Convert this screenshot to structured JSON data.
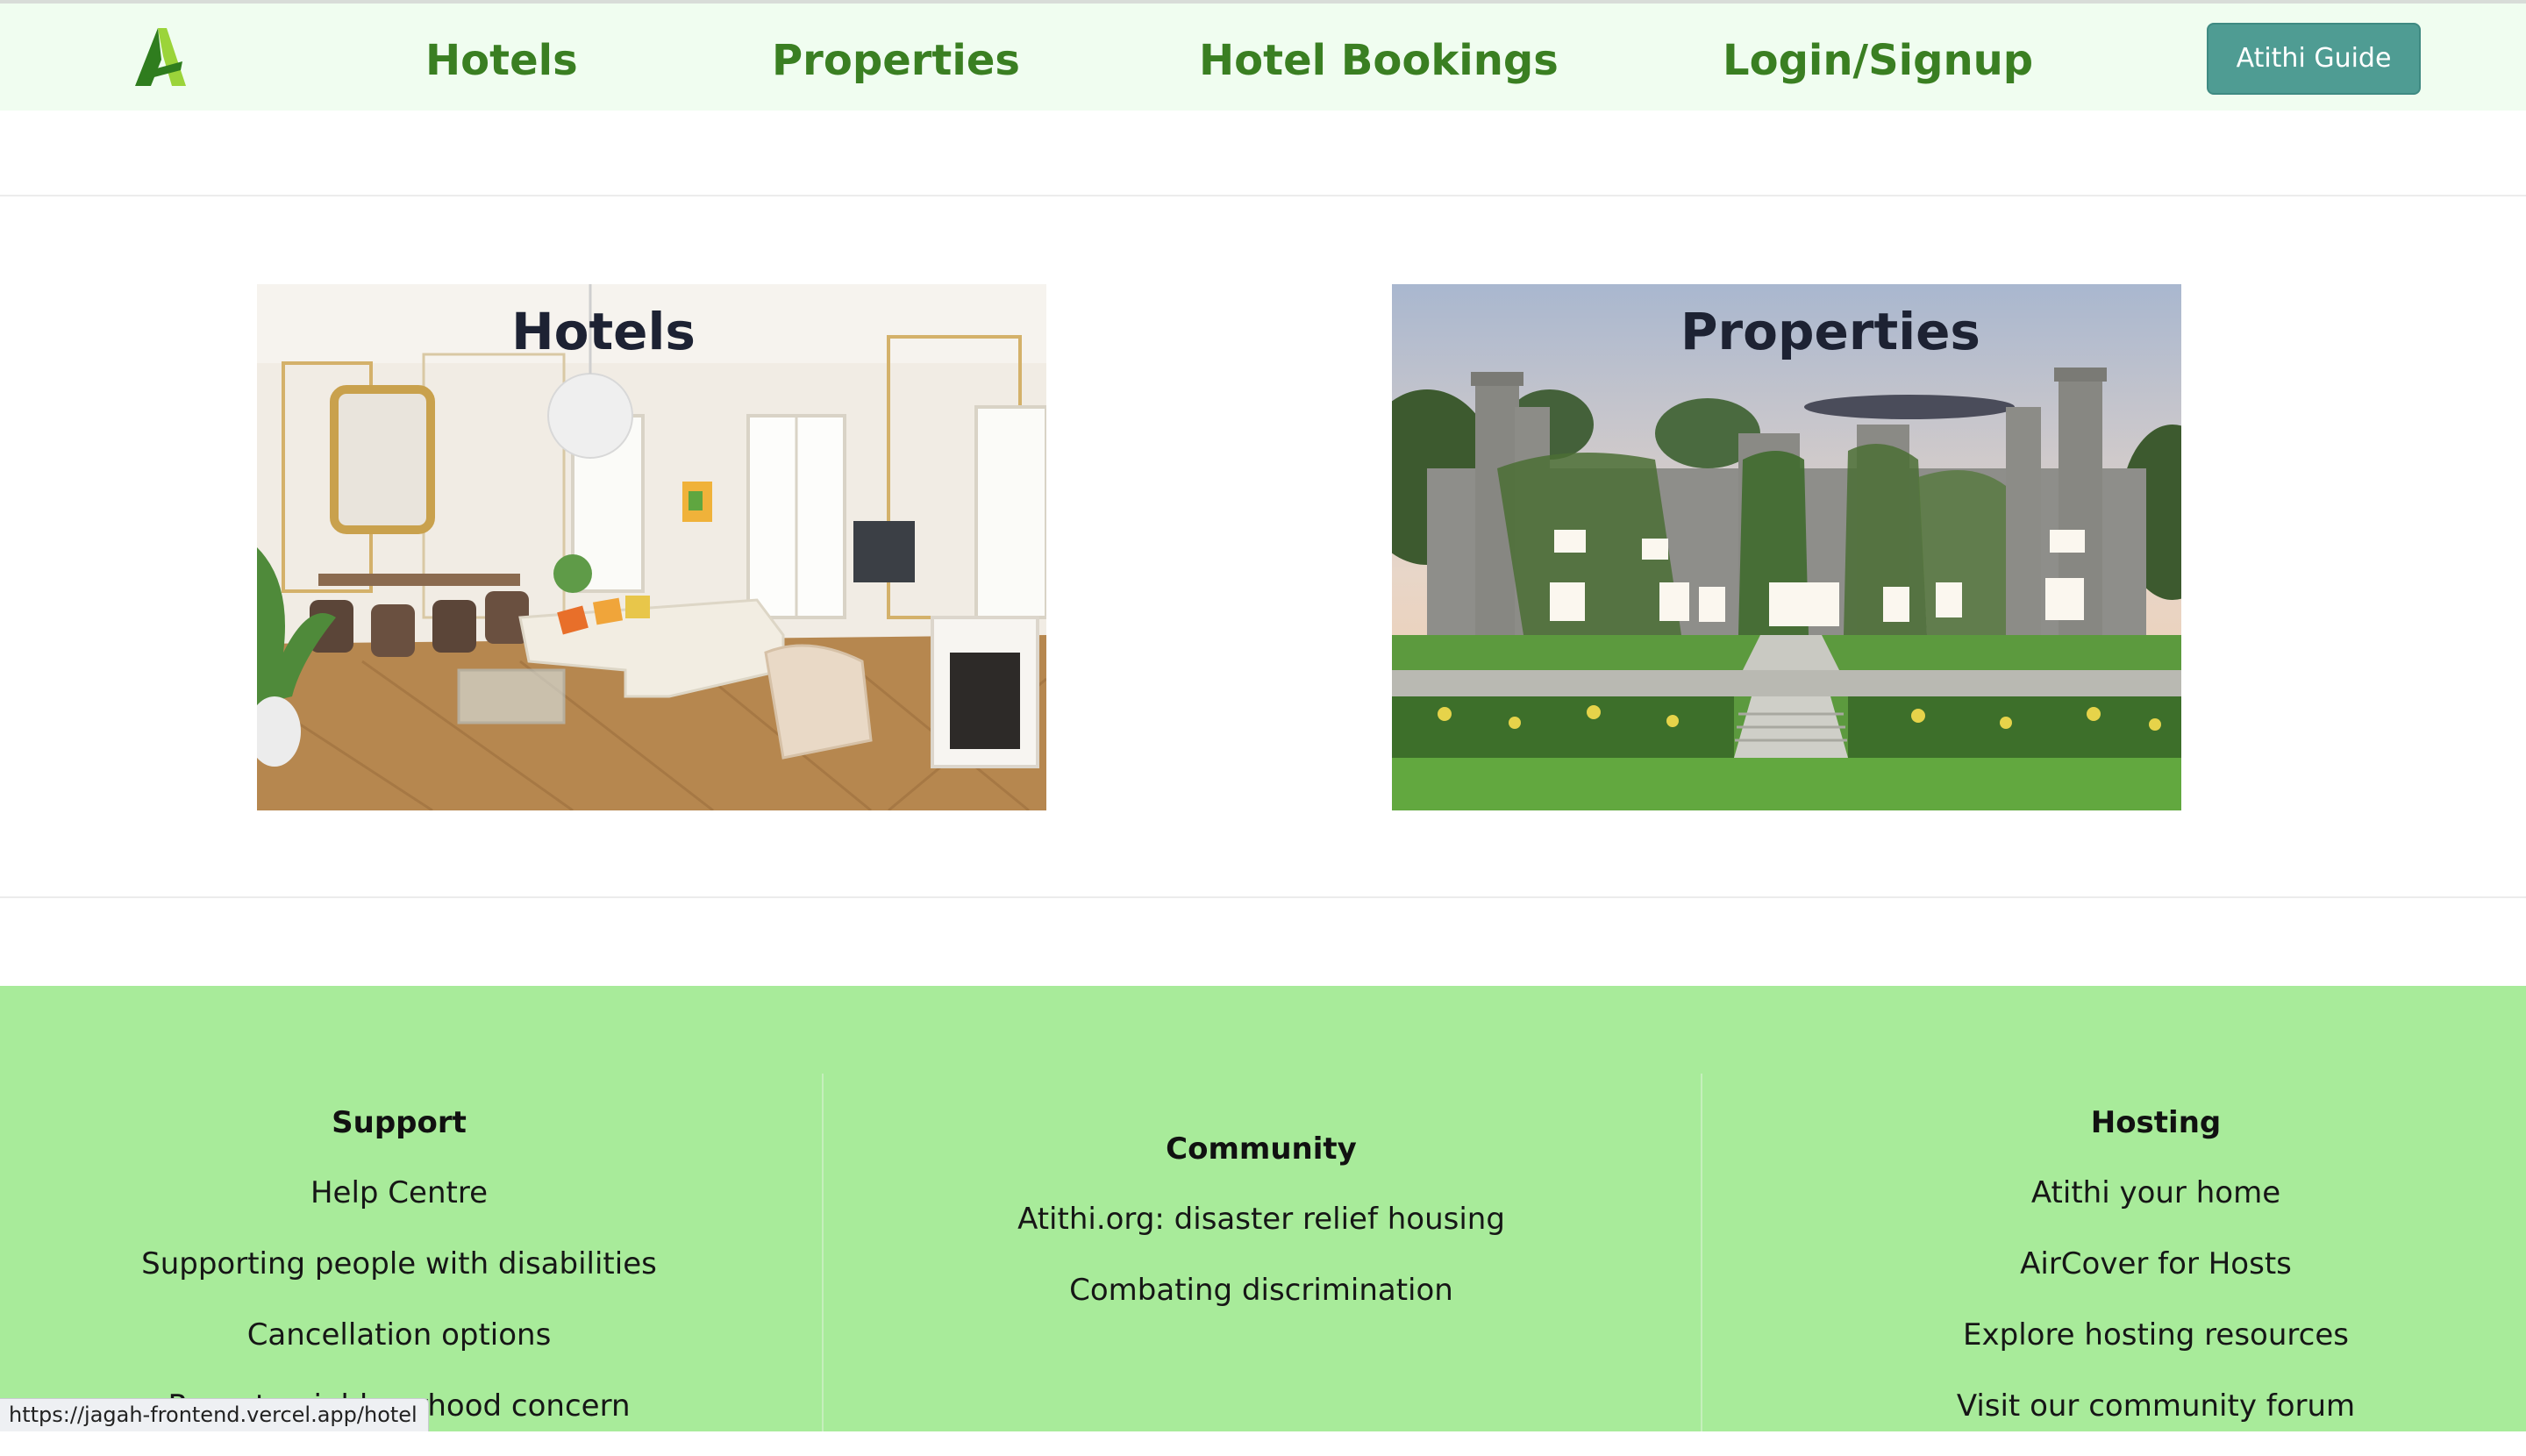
{
  "navbar": {
    "logo_alt": "A",
    "links": {
      "hotels": "Hotels",
      "properties": "Properties",
      "bookings": "Hotel Bookings",
      "login": "Login/Signup"
    },
    "guide_button": "Atithi Guide",
    "colors": {
      "background": "#f0fdf0",
      "link": "#3a7f22",
      "button": "#4f9c93"
    }
  },
  "cards": {
    "hotels": {
      "title": "Hotels",
      "image": "living-room-photo"
    },
    "properties": {
      "title": "Properties",
      "image": "castle-photo"
    }
  },
  "footer": {
    "background": "#a8eb9a",
    "support": {
      "heading": "Support",
      "links": [
        "Help Centre",
        "Supporting people with disabilities",
        "Cancellation options",
        "Report neighbourhood concern"
      ]
    },
    "community": {
      "heading": "Community",
      "links": [
        "Atithi.org: disaster relief housing",
        "Combating discrimination"
      ]
    },
    "hosting": {
      "heading": "Hosting",
      "links": [
        "Atithi your home",
        "AirCover for Hosts",
        "Explore hosting resources",
        "Visit our community forum"
      ]
    }
  },
  "status_bar": {
    "url": "https://jagah-frontend.vercel.app/hotel"
  }
}
